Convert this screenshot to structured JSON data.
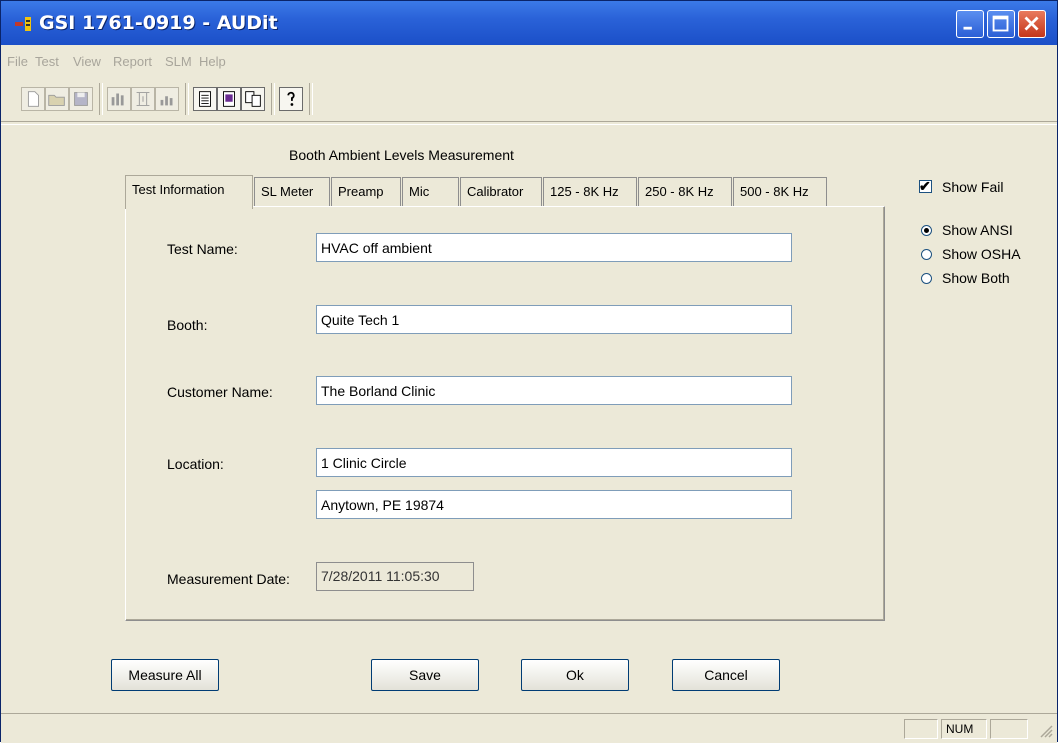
{
  "window": {
    "title": "GSI 1761-0919 - AUDit",
    "minimize_glyph": "_",
    "maximize_glyph": "□",
    "close_glyph": "✕"
  },
  "menu": [
    "File",
    "Test",
    "View",
    "Report",
    "SLM",
    "Help"
  ],
  "toolbar": {
    "icons": [
      "new-icon",
      "open-icon",
      "save-icon",
      "bars-icon",
      "frame-icon",
      "chart-icon",
      "document-icon",
      "monitor-icon",
      "copy-icon",
      "help-icon"
    ]
  },
  "page_title": "Booth Ambient Levels Measurement",
  "tabs": [
    {
      "label": "Test Information",
      "active": true
    },
    {
      "label": "SL Meter",
      "active": false
    },
    {
      "label": "Preamp",
      "active": false
    },
    {
      "label": "Mic",
      "active": false
    },
    {
      "label": "Calibrator",
      "active": false
    },
    {
      "label": "125 - 8K Hz",
      "active": false
    },
    {
      "label": "250 - 8K Hz",
      "active": false
    },
    {
      "label": "500 - 8K Hz",
      "active": false
    }
  ],
  "form": {
    "test_name_label": "Test Name:",
    "test_name_value": "HVAC off ambient",
    "booth_label": "Booth:",
    "booth_value": "Quite Tech 1",
    "customer_label": "Customer Name:",
    "customer_value": "The Borland Clinic",
    "location_label": "Location:",
    "location_line1": "1 Clinic Circle",
    "location_line2": "Anytown, PE 19874",
    "date_label": "Measurement Date:",
    "date_value": "7/28/2011 11:05:30"
  },
  "options": {
    "show_fail_label": "Show Fail",
    "show_fail_checked": true,
    "check_glyph": "✔",
    "radios": [
      {
        "label": "Show ANSI",
        "checked": true
      },
      {
        "label": "Show OSHA",
        "checked": false
      },
      {
        "label": "Show Both",
        "checked": false
      }
    ]
  },
  "buttons": {
    "measure_all": "Measure All",
    "save": "Save",
    "ok": "Ok",
    "cancel": "Cancel"
  },
  "status": {
    "pane1": "",
    "num": "NUM",
    "pane3": ""
  }
}
